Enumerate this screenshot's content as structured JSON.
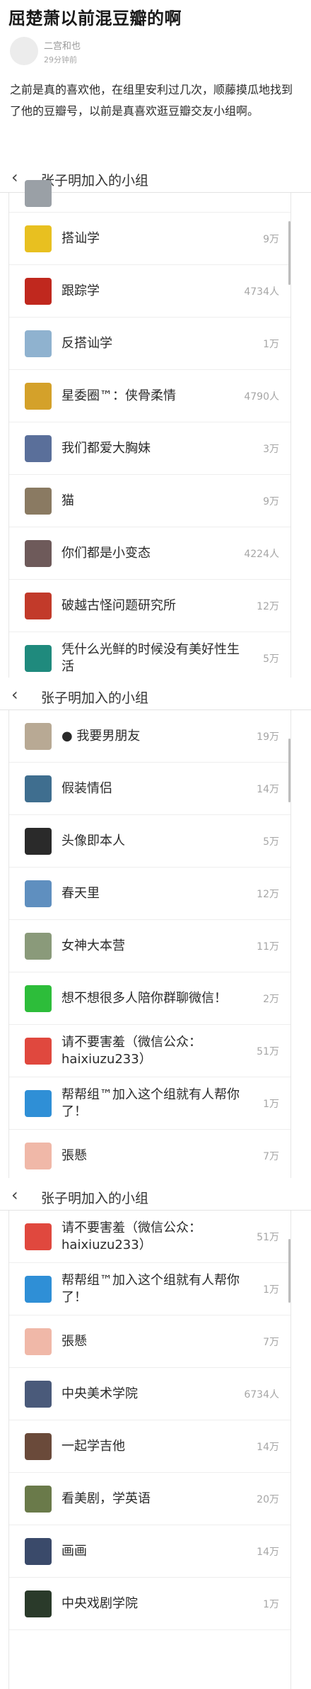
{
  "post": {
    "title": "屈楚萧以前混豆瓣的啊",
    "author": "二宫和也",
    "time": "29分钟前",
    "body": "之前是真的喜欢他，在组里安利过几次，顺藤摸瓜地找到了他的豆瓣号，以前是真喜欢逛豆瓣交友小组啊。"
  },
  "screens": [
    {
      "back_icon": "‹",
      "title": "张子明加入的小组",
      "rows": [
        {
          "name": "",
          "count": "",
          "icon": "partial-icon",
          "color": "#9aa0a6",
          "peek": true
        },
        {
          "name": "搭讪学",
          "count": "9万",
          "icon": "book-icon",
          "color": "#e8c020"
        },
        {
          "name": "跟踪学",
          "count": "4734人",
          "icon": "red-shape-icon",
          "color": "#c0281e"
        },
        {
          "name": "反搭讪学",
          "count": "1万",
          "icon": "people-icon",
          "color": "#8fb2cf"
        },
        {
          "name": "星委圈™：侠骨柔情",
          "count": "4790人",
          "icon": "gold-star-icon",
          "color": "#d4a12a"
        },
        {
          "name": "我们都爱大胸妹",
          "count": "3万",
          "icon": "portrait-icon",
          "color": "#5a6f9a"
        },
        {
          "name": "猫",
          "count": "9万",
          "icon": "cat-icon",
          "color": "#8a7a62"
        },
        {
          "name": "你们都是小变态",
          "count": "4224人",
          "icon": "photo-icon",
          "color": "#6e5a5a"
        },
        {
          "name": "破越古怪问题研究所",
          "count": "12万",
          "icon": "flask-icon",
          "color": "#c23a2a"
        },
        {
          "name": "凭什么光鲜的时候没有美好性生活",
          "count": "5万",
          "icon": "teal-icon",
          "color": "#1f8a7d"
        }
      ]
    },
    {
      "back_icon": "‹",
      "title": "张子明加入的小组",
      "rows": [
        {
          "name": "● 我要男朋友",
          "count": "19万",
          "icon": "sketch-icon",
          "color": "#b8a994"
        },
        {
          "name": "假装情侣",
          "count": "14万",
          "icon": "sea-icon",
          "color": "#3f6e8f"
        },
        {
          "name": "头像即本人",
          "count": "5万",
          "icon": "face-icon",
          "color": "#2a2a2a"
        },
        {
          "name": "春天里",
          "count": "12万",
          "icon": "car-icon",
          "color": "#5f8fbf"
        },
        {
          "name": "女神大本营",
          "count": "11万",
          "icon": "landscape-icon",
          "color": "#8a9a7a"
        },
        {
          "name": "想不想很多人陪你群聊微信！",
          "count": "2万",
          "icon": "wechat-icon",
          "color": "#2dbd3a"
        },
        {
          "name": "请不要害羞（微信公众：haixiuzu233）",
          "count": "51万",
          "icon": "stop-sign-icon",
          "color": "#e0483e"
        },
        {
          "name": "帮帮组™加入这个组就有人帮你了！",
          "count": "1万",
          "icon": "doraemon-icon",
          "color": "#2f8fd6"
        },
        {
          "name": "張懸",
          "count": "7万",
          "icon": "pink-note-icon",
          "color": "#f0b8a8"
        }
      ]
    },
    {
      "back_icon": "‹",
      "title": "张子明加入的小组",
      "rows": [
        {
          "name": "请不要害羞（微信公众：haixiuzu233）",
          "count": "51万",
          "icon": "stop-sign-icon",
          "color": "#e0483e"
        },
        {
          "name": "帮帮组™加入这个组就有人帮你了！",
          "count": "1万",
          "icon": "doraemon-icon",
          "color": "#2f8fd6"
        },
        {
          "name": "張懸",
          "count": "7万",
          "icon": "pink-note-icon",
          "color": "#f0b8a8"
        },
        {
          "name": "中央美术学院",
          "count": "6734人",
          "icon": "calligraphy-icon",
          "color": "#4a5a7a"
        },
        {
          "name": "一起学吉他",
          "count": "14万",
          "icon": "guitar-icon",
          "color": "#6a4a3a"
        },
        {
          "name": "看美剧，学英语",
          "count": "20万",
          "icon": "soldier-icon",
          "color": "#6a7a4a"
        },
        {
          "name": "画画",
          "count": "14万",
          "icon": "painting-icon",
          "color": "#3a4a6a"
        },
        {
          "name": "中央戏剧学院",
          "count": "1万",
          "icon": "theater-icon",
          "color": "#2a3a2a"
        }
      ]
    }
  ]
}
